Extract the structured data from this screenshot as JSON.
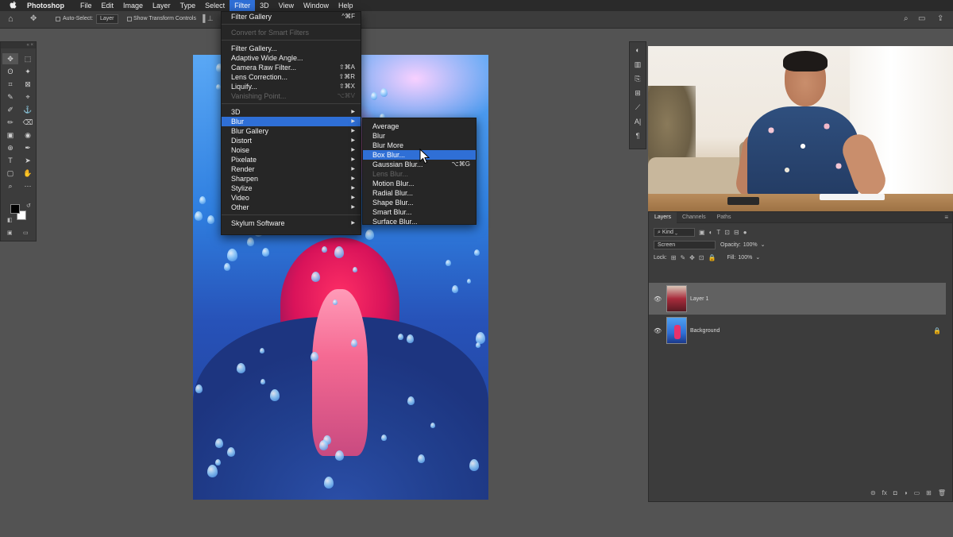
{
  "menubar": {
    "apple": "",
    "app": "Photoshop",
    "items": [
      "File",
      "Edit",
      "Image",
      "Layer",
      "Type",
      "Select",
      "Filter",
      "3D",
      "View",
      "Window",
      "Help"
    ],
    "active": "Filter"
  },
  "options": {
    "home_icon": "⌂",
    "move_icon": "✥",
    "auto_select": "Auto-Select:",
    "layer_select": "Layer",
    "show_transform": "Show Transform Controls",
    "align_icons": "▐ ⊥"
  },
  "tools": {
    "header": "« ×",
    "items": [
      "✥",
      "⬚",
      "ʘ",
      "✦",
      "⌗",
      "⊠",
      "✎",
      "⌖",
      "✐",
      "⚓",
      "✏",
      "⌫",
      "▣",
      "◉",
      "⊕",
      "✒",
      "T",
      "➤",
      "▢",
      "✋",
      "⌕",
      "⋯"
    ]
  },
  "filter_menu": {
    "top": [
      {
        "label": "Filter Gallery",
        "shortcut": "^⌘F",
        "disabled": false
      }
    ],
    "smart": [
      {
        "label": "Convert for Smart Filters",
        "disabled": true
      }
    ],
    "group1": [
      {
        "label": "Filter Gallery...",
        "shortcut": ""
      },
      {
        "label": "Adaptive Wide Angle...",
        "shortcut": ""
      },
      {
        "label": "Camera Raw Filter...",
        "shortcut": "⇧⌘A"
      },
      {
        "label": "Lens Correction...",
        "shortcut": "⇧⌘R"
      },
      {
        "label": "Liquify...",
        "shortcut": "⇧⌘X"
      },
      {
        "label": "Vanishing Point...",
        "shortcut": "⌥⌘V",
        "disabled": true
      }
    ],
    "submenus": [
      "3D",
      "Blur",
      "Blur Gallery",
      "Distort",
      "Noise",
      "Pixelate",
      "Render",
      "Sharpen",
      "Stylize",
      "Video",
      "Other"
    ],
    "highlighted": "Blur",
    "extra": [
      "Skylum Software"
    ],
    "arrow": "▶"
  },
  "blur_menu": {
    "items": [
      {
        "label": "Average",
        "shortcut": ""
      },
      {
        "label": "Blur",
        "shortcut": ""
      },
      {
        "label": "Blur More",
        "shortcut": ""
      },
      {
        "label": "Box Blur...",
        "shortcut": "",
        "highlighted": true
      },
      {
        "label": "Gaussian Blur...",
        "shortcut": "⌥⌘G"
      },
      {
        "label": "Lens Blur...",
        "shortcut": "",
        "disabled": true
      },
      {
        "label": "Motion Blur...",
        "shortcut": ""
      },
      {
        "label": "Radial Blur...",
        "shortcut": ""
      },
      {
        "label": "Shape Blur...",
        "shortcut": ""
      },
      {
        "label": "Smart Blur...",
        "shortcut": ""
      },
      {
        "label": "Surface Blur...",
        "shortcut": ""
      }
    ]
  },
  "right_panel_icons": [
    "◐",
    "▥",
    "⎘",
    "⊞",
    "⟋",
    "A|",
    "¶"
  ],
  "layers_panel": {
    "tabs": [
      "Layers",
      "Channels",
      "Paths"
    ],
    "active_tab": "Layers",
    "kind": "Kind",
    "blend_mode": "Screen",
    "opacity_label": "Opacity:",
    "opacity": "100%",
    "lock_label": "Lock:",
    "fill_label": "Fill:",
    "fill": "100%",
    "layers": [
      {
        "name": "Layer 1",
        "visible": true,
        "selected": true,
        "locked": false
      },
      {
        "name": "Background",
        "visible": true,
        "selected": false,
        "locked": true
      }
    ],
    "footer_icons": [
      "⊝",
      "fx",
      "◘",
      "◑",
      "▭",
      "⊞",
      "🗑"
    ]
  },
  "colors": {
    "menu_highlight": "#2f6fd6",
    "panel_bg": "#3c3c3c",
    "workspace_bg": "#535353"
  }
}
